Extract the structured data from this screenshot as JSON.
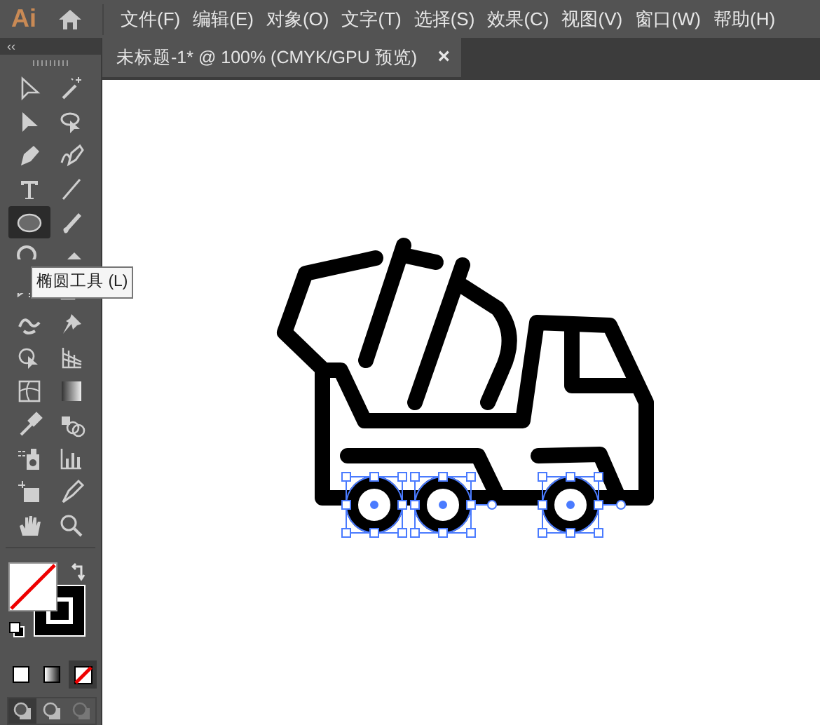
{
  "app_logo": "Ai",
  "menu": [
    "文件(F)",
    "编辑(E)",
    "对象(O)",
    "文字(T)",
    "选择(S)",
    "效果(C)",
    "视图(V)",
    "窗口(W)",
    "帮助(H)"
  ],
  "document_tab": {
    "title": "未标题-1* @ 100% (CMYK/GPU 预览)",
    "close": "×"
  },
  "toolbar": {
    "collapse": "‹‹",
    "tools": [
      {
        "selected": false
      },
      {
        "selected": false
      },
      {
        "selected": false
      },
      {
        "selected": false
      },
      {
        "selected": false
      },
      {
        "selected": false
      },
      {
        "selected": false
      },
      {
        "selected": false
      },
      {
        "selected": true
      },
      {
        "selected": false
      },
      {
        "selected": false
      },
      {
        "selected": false
      },
      {
        "selected": false
      },
      {
        "selected": false
      },
      {
        "selected": false
      },
      {
        "selected": false
      },
      {
        "selected": false
      },
      {
        "selected": false
      },
      {
        "selected": false
      },
      {
        "selected": false
      },
      {
        "selected": false
      },
      {
        "selected": false
      },
      {
        "selected": false
      },
      {
        "selected": false
      },
      {
        "selected": false
      },
      {
        "selected": false
      },
      {
        "selected": false
      },
      {
        "selected": false
      }
    ],
    "color_modes": [
      {
        "selected": false
      },
      {
        "selected": false
      },
      {
        "selected": true
      }
    ],
    "draw_modes": [
      {
        "selected": true
      },
      {
        "selected": false
      },
      {
        "selected": false
      }
    ]
  },
  "tooltip": "椭圆工具 (L)"
}
